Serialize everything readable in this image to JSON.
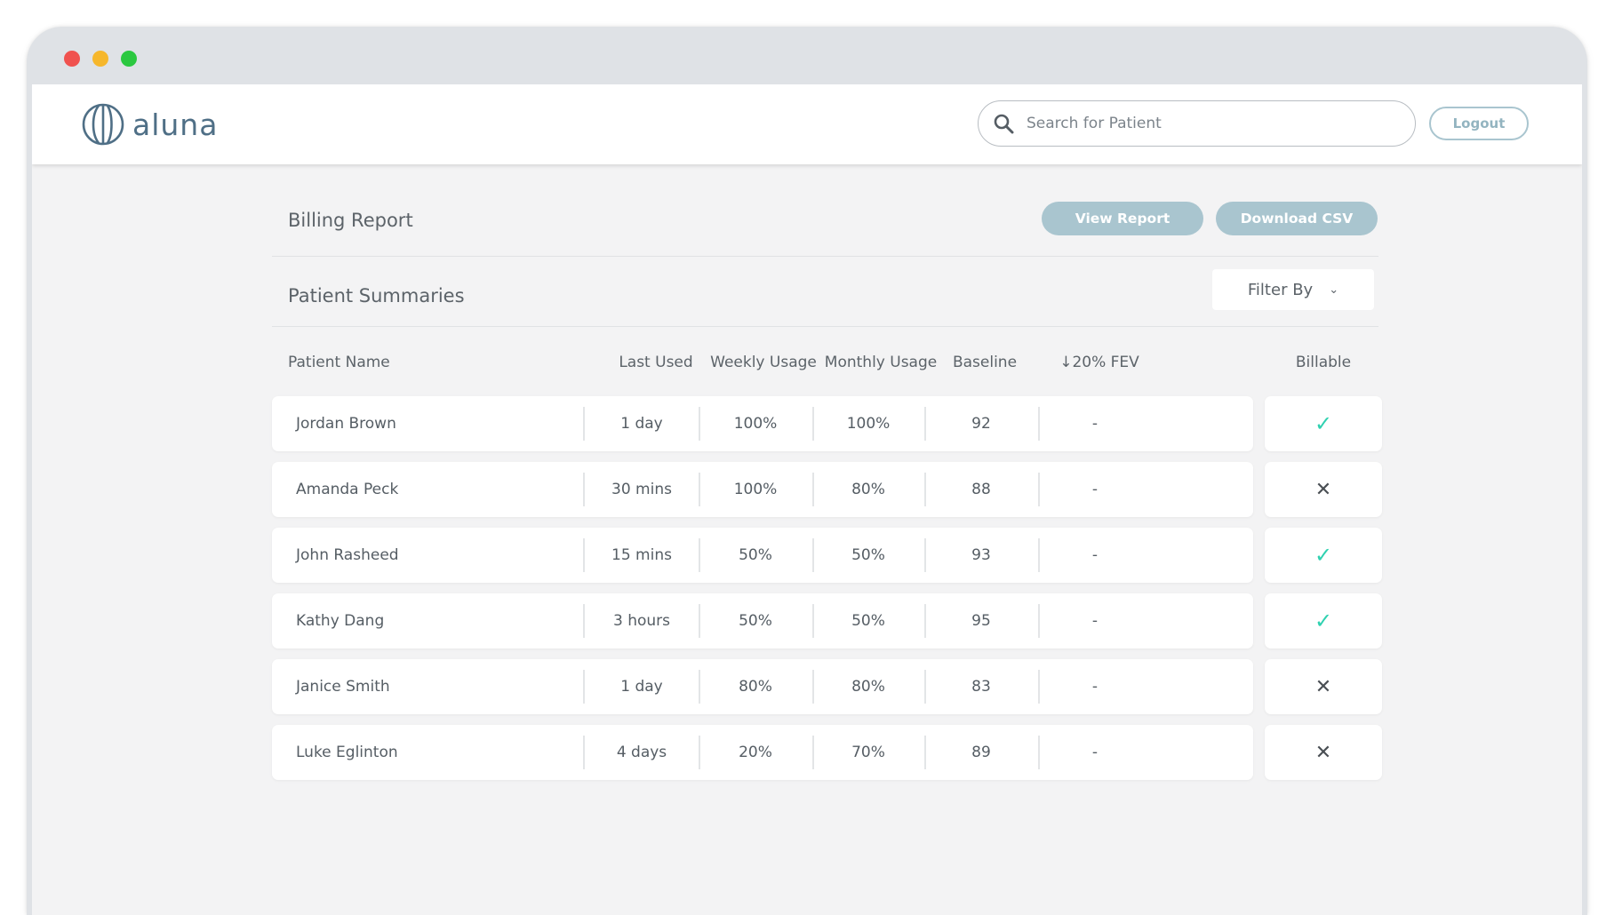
{
  "header": {
    "brand": "aluna",
    "search_placeholder": "Search for Patient",
    "logout_label": "Logout"
  },
  "report": {
    "title": "Billing Report",
    "view_report_label": "View Report",
    "download_csv_label": "Download CSV"
  },
  "summaries": {
    "title": "Patient Summaries",
    "filter_label": "Filter By"
  },
  "table": {
    "columns": [
      "Patient Name",
      "Last Used",
      "Weekly Usage",
      "Monthly Usage",
      "Baseline",
      "↓20% FEV",
      "Billable"
    ],
    "rows": [
      {
        "name": "Jordan Brown",
        "last_used": "1 day",
        "weekly": "100%",
        "monthly": "100%",
        "baseline": "92",
        "fev": "-",
        "billable": true
      },
      {
        "name": "Amanda Peck",
        "last_used": "30 mins",
        "weekly": "100%",
        "monthly": "80%",
        "baseline": "88",
        "fev": "-",
        "billable": false
      },
      {
        "name": "John Rasheed",
        "last_used": "15 mins",
        "weekly": "50%",
        "monthly": "50%",
        "baseline": "93",
        "fev": "-",
        "billable": true
      },
      {
        "name": "Kathy Dang",
        "last_used": "3 hours",
        "weekly": "50%",
        "monthly": "50%",
        "baseline": "95",
        "fev": "-",
        "billable": true
      },
      {
        "name": "Janice Smith",
        "last_used": "1 day",
        "weekly": "80%",
        "monthly": "80%",
        "baseline": "83",
        "fev": "-",
        "billable": false
      },
      {
        "name": "Luke Eglinton",
        "last_used": "4 days",
        "weekly": "20%",
        "monthly": "70%",
        "baseline": "89",
        "fev": "-",
        "billable": false
      }
    ]
  },
  "colors": {
    "accent": "#a9c5cf",
    "check": "#2fd1b0",
    "brand": "#4f6f86"
  },
  "icons": {
    "billable_true": "check-icon",
    "billable_false": "close-icon"
  }
}
